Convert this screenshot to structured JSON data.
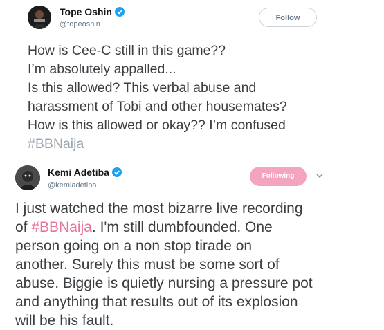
{
  "tweets": [
    {
      "name": "Tope Oshin",
      "handle": "@topeoshin",
      "button_label": "Follow",
      "lines": [
        "How is Cee-C still in this game??",
        "I’m absolutely appalled...",
        "Is this allowed? This verbal abuse and",
        "harassment of Tobi and other housemates?",
        "How is this allowed or okay?? I’m confused"
      ],
      "hashtag": "#BBNaija",
      "colors": {
        "hashtag": "#9aa5af",
        "text": "#3b3f42"
      }
    },
    {
      "name": "Kemi Adetiba",
      "handle": "@kemiadetiba",
      "button_label": "Following",
      "line1_before": "I just watched the most bizarre live recording",
      "line2_prefix": "of ",
      "hashtag": "#BBNaija",
      "line2_suffix": ". I'm still dumbfounded. One",
      "lines_after": [
        "person going on a non stop tirade on",
        "another. Surely this must be some sort of",
        "abuse. Biggie is quietly nursing a pressure pot",
        "and anything that results out of its explosion",
        "will be his fault."
      ],
      "colors": {
        "hashtag": "#e8739e",
        "button": "#f4a3c0",
        "text": "#3b3f42"
      }
    }
  ],
  "icons": {
    "verified": "verified-badge-icon",
    "chevron": "chevron-down-icon"
  }
}
